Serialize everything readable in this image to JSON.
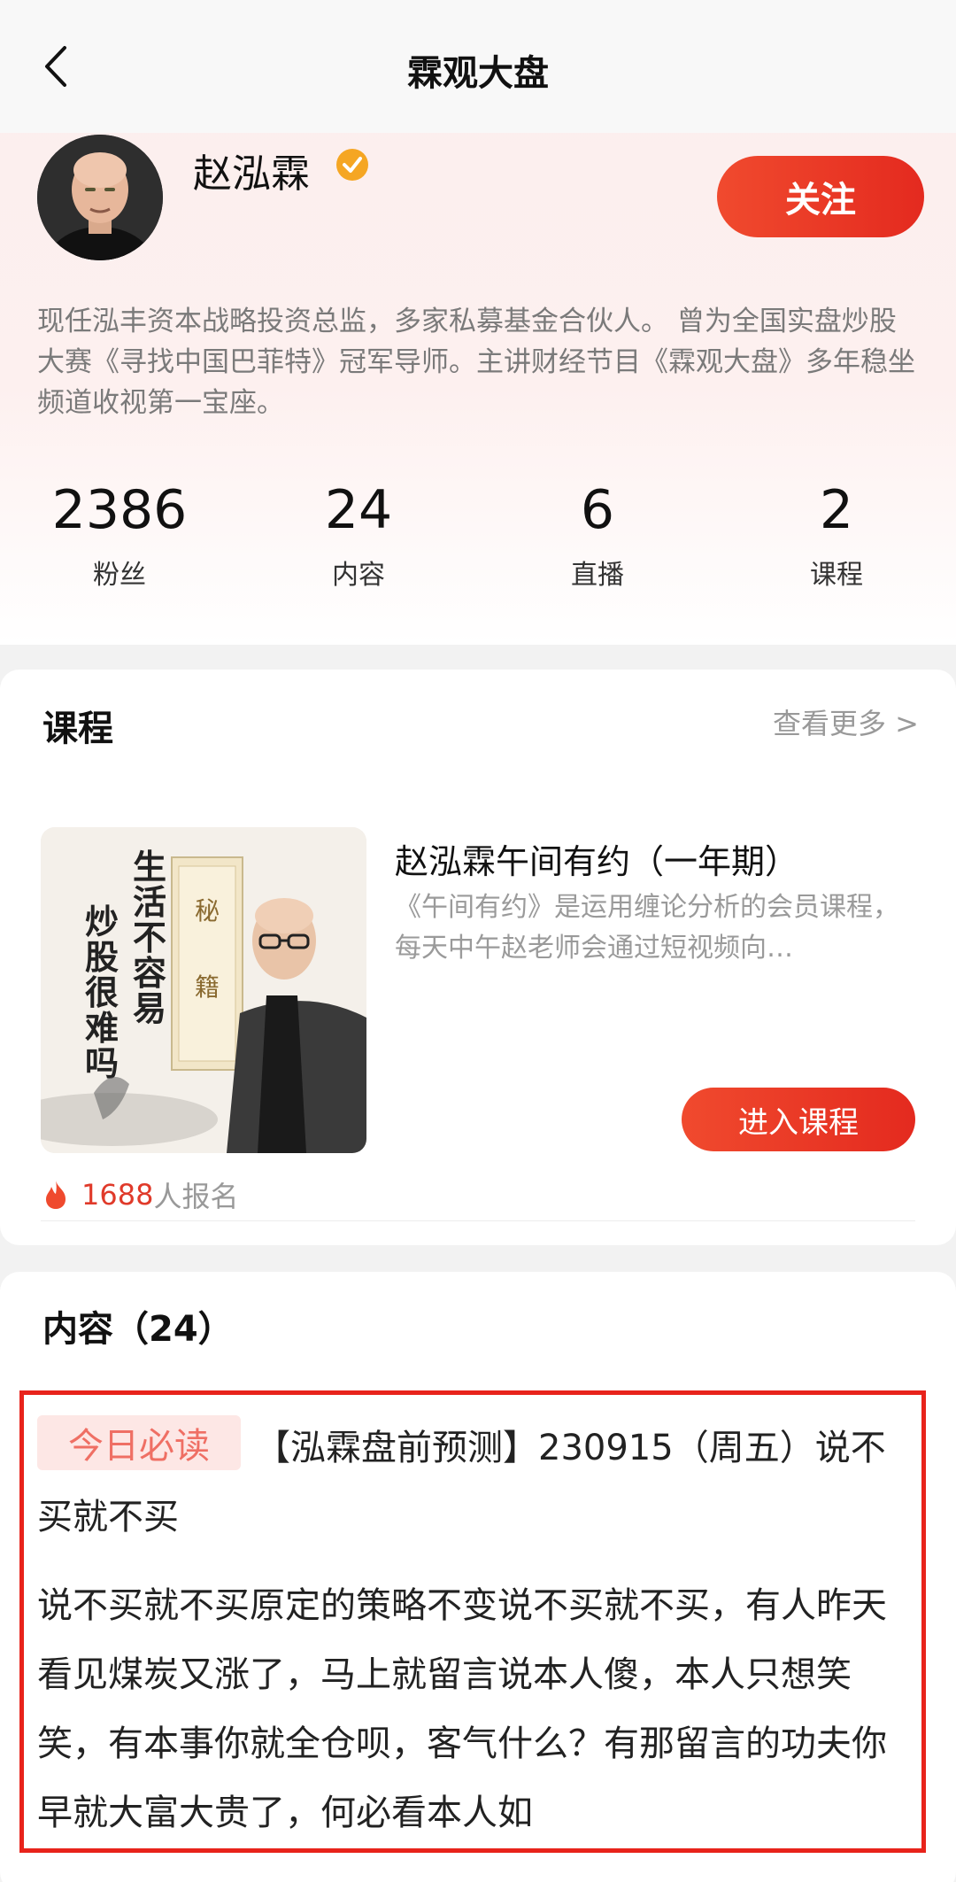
{
  "nav": {
    "title": "霖观大盘"
  },
  "profile": {
    "name": "赵泓霖",
    "follow_label": "关注",
    "bio": "现任泓丰资本战略投资总监，多家私募基金合伙人。 曾为全国实盘炒股大赛《寻找中国巴菲特》冠军导师。主讲财经节目《霖观大盘》多年稳坐频道收视第一宝座。"
  },
  "stats": [
    {
      "value": "2386",
      "label": "粉丝"
    },
    {
      "value": "24",
      "label": "内容"
    },
    {
      "value": "6",
      "label": "直播"
    },
    {
      "value": "2",
      "label": "课程"
    }
  ],
  "course_section": {
    "title": "课程",
    "see_more": "查看更多 >",
    "course": {
      "title": "赵泓霖午间有约（一年期）",
      "description": "《午间有约》是运用缠论分析的会员课程，每天中午赵老师会通过短视频向…",
      "cover_text_1": "生活不容易",
      "cover_text_2": "炒股很难吗",
      "cover_scroll": "秘 籍",
      "enter_label": "进入课程",
      "enroll_count": "1688",
      "enroll_suffix": "人报名"
    }
  },
  "content_section": {
    "title": "内容（24）",
    "post": {
      "tag": "今日必读",
      "title": "【泓霖盘前预测】230915（周五）说不买就不买",
      "body": "说不买就不买原定的策略不变说不买就不买，有人昨天看见煤炭又涨了，马上就留言说本人傻，本人只想笑笑，有本事你就全仓呗，客气什么？有那留言的功夫你早就大富大贵了，何必看本人如"
    }
  },
  "colors": {
    "accent": "#e42a1f",
    "tag_bg": "#fde7e5",
    "tag_text": "#ef6f64",
    "verified": "#f5a623"
  }
}
